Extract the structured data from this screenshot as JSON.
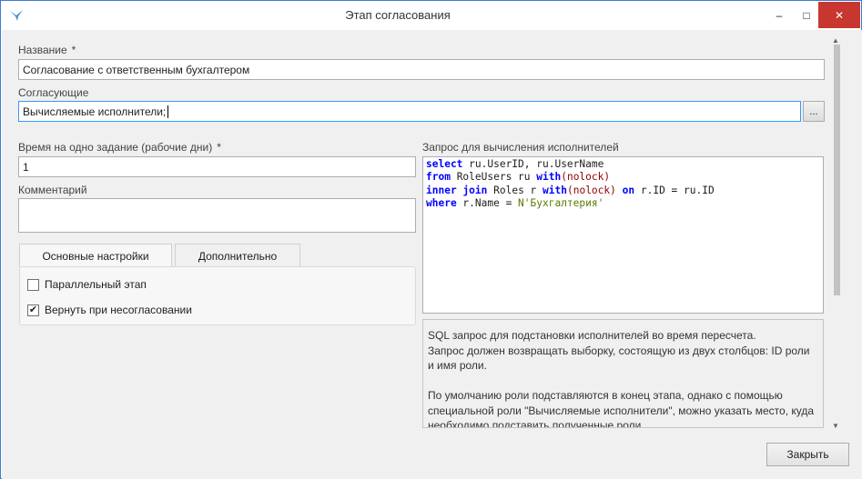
{
  "window": {
    "title": "Этап согласования",
    "controls": {
      "minimize": "–",
      "maximize": "□",
      "close": "✕"
    }
  },
  "form": {
    "name": {
      "label": "Название",
      "required_mark": "*",
      "value": "Согласование с ответственным бухгалтером"
    },
    "approvers": {
      "label": "Согласующие",
      "value": "Вычисляемые исполнители;",
      "browse_button": "..."
    },
    "time": {
      "label": "Время на одно задание (рабочие дни)",
      "required_mark": "*",
      "value": "1"
    },
    "comment": {
      "label": "Комментарий",
      "value": ""
    },
    "tabs": [
      {
        "label": "Основные настройки",
        "active": true
      },
      {
        "label": "Дополнительно",
        "active": false
      }
    ],
    "options": [
      {
        "label": "Параллельный этап",
        "checked": false
      },
      {
        "label": "Вернуть при несогласовании",
        "checked": true
      }
    ],
    "query": {
      "label": "Запрос для вычисления исполнителей",
      "lines": [
        "select ru.UserID, ru.UserName",
        "from RoleUsers ru with(nolock)",
        "inner join Roles r with(nolock) on r.ID = ru.ID",
        "where r.Name = N'Бухгалтерия'"
      ]
    },
    "help": {
      "paragraphs": [
        "SQL запрос для подстановки исполнителей во время пересчета.",
        "Запрос должен возвращать выборку, состоящую из двух столбцов: ID роли и имя роли.",
        "",
        "По умолчанию роли подставляются в конец этапа, однако с помощью специальной роли \"Вычисляемые исполнители\",  можно указать место, куда необходимо подставить полученные роли."
      ]
    }
  },
  "footer": {
    "close_button": "Закрыть"
  },
  "colors": {
    "accent": "#3399ff",
    "close_hover": "#c7372f",
    "keyword": "#0000ff",
    "function": "#8b0000",
    "string": "#5a7a00"
  }
}
